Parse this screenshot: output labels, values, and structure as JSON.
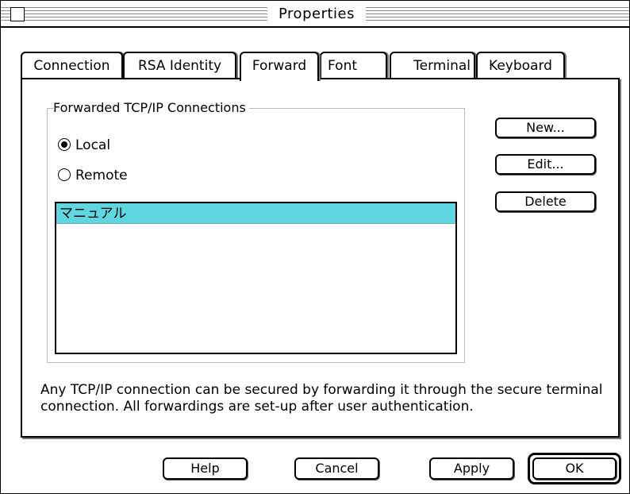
{
  "window": {
    "title": "Properties"
  },
  "tabs": [
    {
      "label": "Connection",
      "active": false
    },
    {
      "label": "RSA Identity",
      "active": false
    },
    {
      "label": "Forward",
      "active": true
    },
    {
      "label": "Font",
      "active": false
    },
    {
      "label": "Terminal",
      "active": false
    },
    {
      "label": "Keyboard",
      "active": false
    }
  ],
  "forward": {
    "group_title": "Forwarded TCP/IP Connections",
    "radio_local": {
      "label": "Local",
      "checked": true
    },
    "radio_remote": {
      "label": "Remote",
      "checked": false
    },
    "list_items": [
      "マニュアル"
    ],
    "selected_color": "#5fd6e0",
    "buttons": {
      "new": "New...",
      "edit": "Edit...",
      "delete": "Delete"
    },
    "description": "Any TCP/IP connection can be secured by forwarding it through the secure terminal connection. All forwardings are set-up after user authentication."
  },
  "footer": {
    "help": "Help",
    "cancel": "Cancel",
    "apply": "Apply",
    "ok": "OK"
  }
}
